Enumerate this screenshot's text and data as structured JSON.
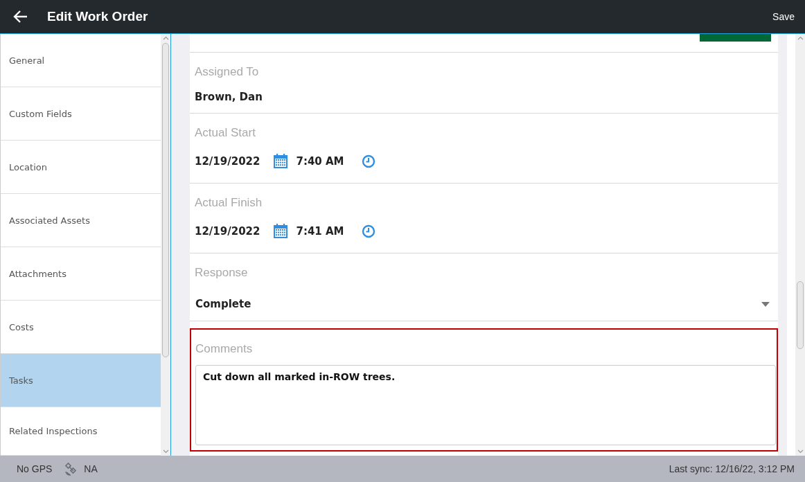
{
  "header": {
    "title": "Edit Work Order",
    "action": "Save"
  },
  "sidebar": {
    "items": [
      {
        "label": "General",
        "selected": false
      },
      {
        "label": "Custom Fields",
        "selected": false
      },
      {
        "label": "Location",
        "selected": false
      },
      {
        "label": "Associated Assets",
        "selected": false
      },
      {
        "label": "Attachments",
        "selected": false
      },
      {
        "label": "Costs",
        "selected": false
      },
      {
        "label": "Tasks",
        "selected": true
      },
      {
        "label": "Related Inspections",
        "selected": false
      }
    ]
  },
  "form": {
    "fields": [
      {
        "kind": "text",
        "label": "Assigned To",
        "value": "Brown, Dan",
        "highlighted": false
      },
      {
        "kind": "datetime",
        "label": "Actual Start",
        "date": "12/19/2022",
        "time": "7:40 AM",
        "highlighted": false
      },
      {
        "kind": "datetime",
        "label": "Actual Finish",
        "date": "12/19/2022",
        "time": "7:41 AM",
        "highlighted": false
      },
      {
        "kind": "dropdown",
        "label": "Response",
        "value": "Complete",
        "highlighted": false
      },
      {
        "kind": "textarea",
        "label": "Comments",
        "value": "Cut down all marked in-ROW trees.",
        "highlighted": true
      }
    ]
  },
  "status_bar": {
    "gps": "No GPS",
    "signal": "NA",
    "last_sync": "Last sync: 12/16/22, 3:12 PM"
  }
}
